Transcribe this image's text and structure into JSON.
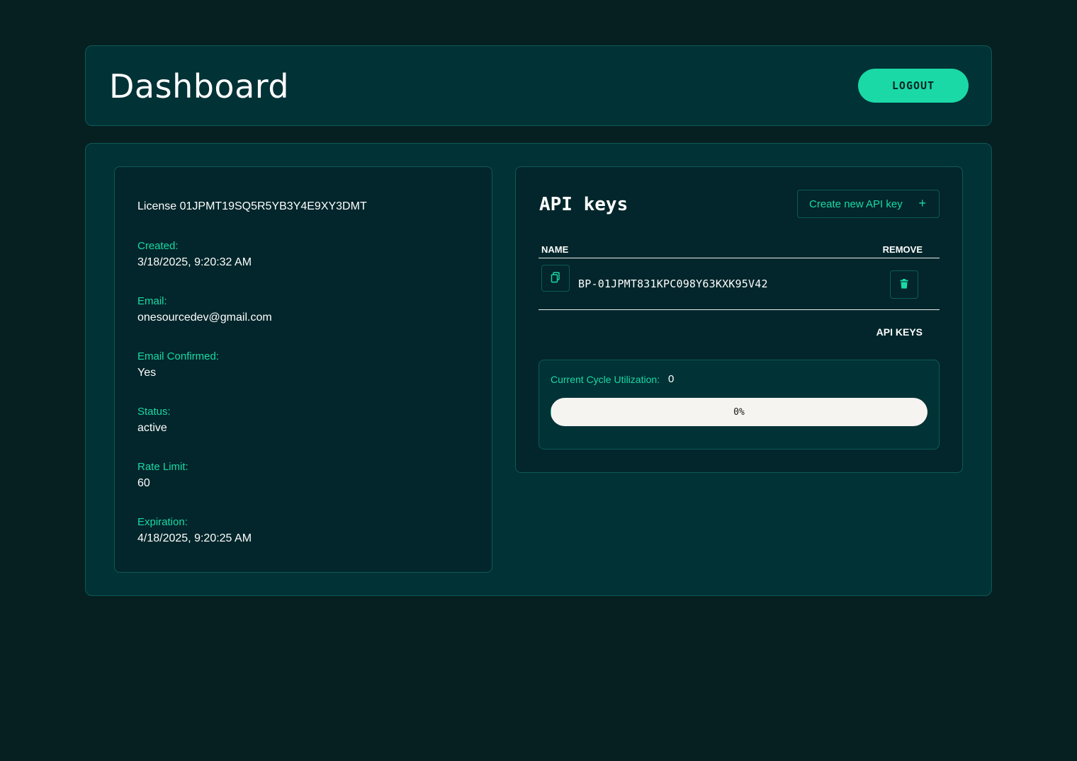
{
  "header": {
    "title": "Dashboard",
    "logout_label": "LOGOUT"
  },
  "license": {
    "title": "License 01JPMT19SQ5R5YB3Y4E9XY3DMT",
    "fields": [
      {
        "label": "Created:",
        "value": "3/18/2025, 9:20:32 AM"
      },
      {
        "label": "Email:",
        "value": "onesourcedev@gmail.com"
      },
      {
        "label": "Email Confirmed:",
        "value": "Yes"
      },
      {
        "label": "Status:",
        "value": "active"
      },
      {
        "label": "Rate Limit:",
        "value": "60"
      },
      {
        "label": "Expiration:",
        "value": "4/18/2025, 9:20:25 AM"
      }
    ]
  },
  "api_keys": {
    "title": "API keys",
    "create_label": "Create new API key",
    "create_icon": "plus-icon",
    "columns": {
      "name": "NAME",
      "remove": "REMOVE"
    },
    "rows": [
      {
        "key": "BP-01JPMT831KPC098Y63KXK95V42",
        "copy_icon": "copy-icon",
        "remove_icon": "trash-icon"
      }
    ],
    "caption": "API KEYS"
  },
  "utilization": {
    "label": "Current Cycle Utilization:",
    "value": "0",
    "progress_percent": 0,
    "progress_text": "0%"
  },
  "colors": {
    "background": "#061f21",
    "panel": "#013236",
    "card": "#02262b",
    "accent": "#1ad9a6",
    "border": "#0e5a55"
  }
}
